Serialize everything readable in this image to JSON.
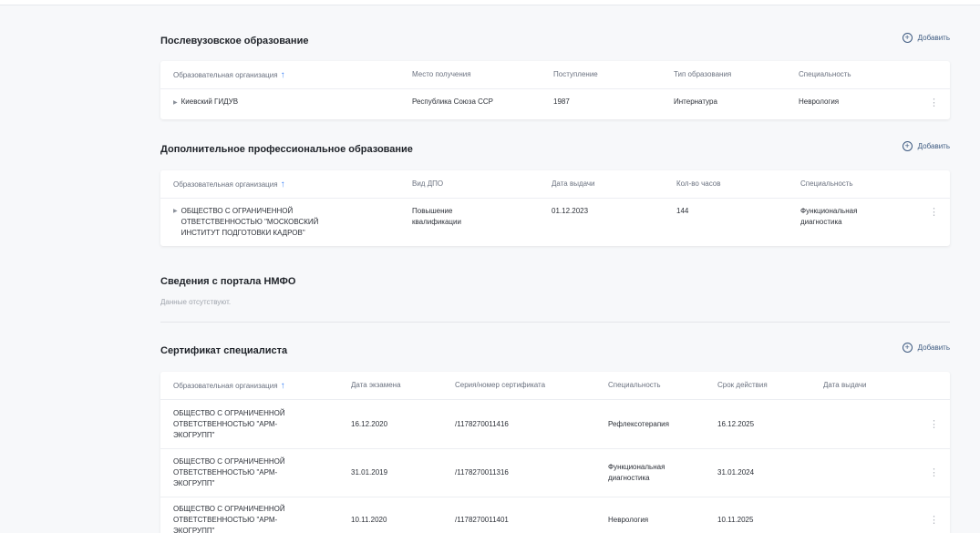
{
  "postgrad": {
    "title": "Послевузовское образование",
    "add_label": "Добавить",
    "headers": [
      "Образовательная организация",
      "Место получения",
      "Поступление",
      "Тип образования",
      "Специальность"
    ],
    "rows": [
      {
        "org": "Киевский ГИДУВ",
        "place": "Республика Союза ССР",
        "year": "1987",
        "type": "Интернатура",
        "spec": "Неврология"
      }
    ]
  },
  "dpo": {
    "title": "Дополнительное профессиональное образование",
    "add_label": "Добавить",
    "headers": [
      "Образовательная организация",
      "Вид ДПО",
      "Дата выдачи",
      "Кол-во часов",
      "Специальность"
    ],
    "rows": [
      {
        "org": "ОБЩЕСТВО С ОГРАНИЧЕННОЙ ОТВЕТСТВЕННОСТЬЮ \"МОСКОВСКИЙ ИНСТИТУТ ПОДГОТОВКИ КАДРОВ\"",
        "kind": "Повышение квалификации",
        "date": "01.12.2023",
        "hours": "144",
        "spec": "Функциональная диагностика"
      }
    ]
  },
  "nmfo": {
    "title": "Сведения с портала НМФО",
    "empty_text": "Данные отсутствуют."
  },
  "cert": {
    "title": "Сертификат специалиста",
    "add_label": "Добавить",
    "headers": [
      "Образовательная организация",
      "Дата экзамена",
      "Серия/номер сертификата",
      "Специальность",
      "Срок действия",
      "Дата выдачи"
    ],
    "rows": [
      {
        "org": "ОБЩЕСТВО С ОГРАНИЧЕННОЙ ОТВЕТСТВЕННОСТЬЮ \"АРМ-ЭКОГРУПП\"",
        "exam": "16.12.2020",
        "number": "/1178270011416",
        "spec": "Рефлексотерапия",
        "valid": "16.12.2025",
        "issued": ""
      },
      {
        "org": "ОБЩЕСТВО С ОГРАНИЧЕННОЙ ОТВЕТСТВЕННОСТЬЮ \"АРМ-ЭКОГРУПП\"",
        "exam": "31.01.2019",
        "number": "/1178270011316",
        "spec": "Функциональная диагностика",
        "valid": "31.01.2024",
        "issued": ""
      },
      {
        "org": "ОБЩЕСТВО С ОГРАНИЧЕННОЙ ОТВЕТСТВЕННОСТЬЮ \"АРМ-ЭКОГРУПП\"",
        "exam": "10.11.2020",
        "number": "/1178270011401",
        "spec": "Неврология",
        "valid": "10.11.2025",
        "issued": ""
      }
    ]
  },
  "icons": {
    "add": "plus-circle-icon",
    "sort": "arrow-up-icon",
    "expand": "caret-right-icon",
    "menu": "kebab-menu-icon"
  }
}
